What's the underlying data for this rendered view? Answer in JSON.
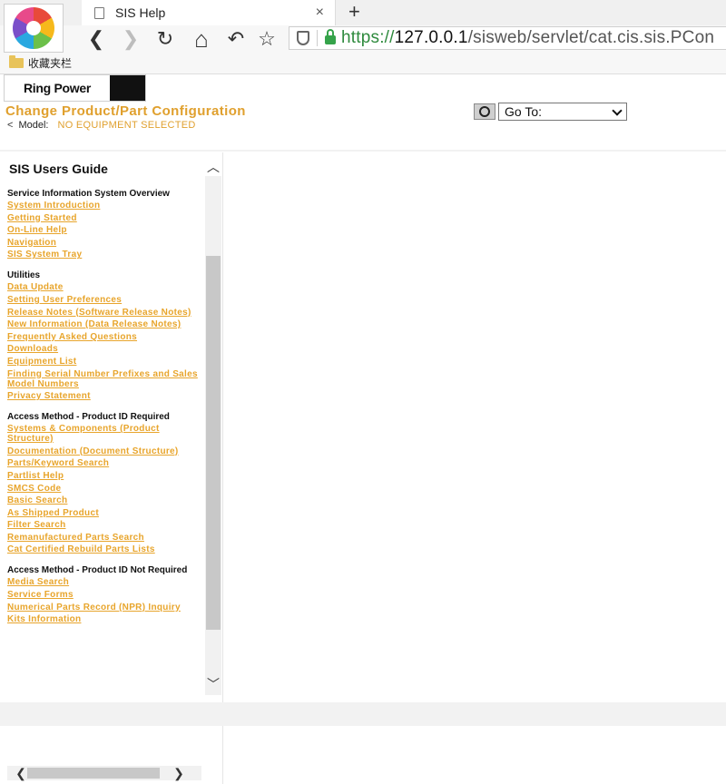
{
  "browser": {
    "tab_title": "SIS Help",
    "tab_close": "×",
    "new_tab": "+",
    "url_scheme": "https://",
    "url_host": "127.0.0.1",
    "url_path": "/sisweb/servlet/cat.cis.sis.PCon",
    "bookmark_folder_label": "收藏夹栏",
    "nav": {
      "back": "❮",
      "forward": "❯",
      "reload": "↻",
      "home": "⌂",
      "undo": "↶",
      "favorite": "☆"
    }
  },
  "header": {
    "brand_text": "Ring Power",
    "page_title": "Change Product/Part Configuration",
    "back_caret": "<",
    "model_label": "Model:",
    "model_value": "NO EQUIPMENT SELECTED",
    "goto_label": "Go To:"
  },
  "guide": {
    "title": "SIS Users Guide",
    "scroll_up": "︿",
    "scroll_down": "﹀",
    "scroll_left": "❮",
    "scroll_right": "❯",
    "sections": [
      {
        "heading": "Service Information System Overview",
        "links": [
          "System Introduction",
          "Getting Started",
          "On-Line Help",
          "Navigation",
          "SIS System Tray"
        ]
      },
      {
        "heading": "Utilities",
        "links": [
          "Data Update",
          "Setting User Preferences",
          "Release Notes (Software Release Notes)",
          "New Information (Data Release Notes)",
          "Frequently Asked Questions",
          "Downloads",
          "Equipment List",
          "Finding Serial Number Prefixes and Sales Model Numbers",
          "Privacy Statement"
        ]
      },
      {
        "heading": "Access Method - Product ID Required",
        "links": [
          "Systems & Components (Product Structure)",
          "Documentation (Document Structure)",
          "Parts/Keyword Search",
          "Partlist Help",
          "SMCS Code",
          "Basic Search",
          "As Shipped Product",
          "Filter Search",
          "Remanufactured Parts Search",
          "Cat Certified Rebuild Parts Lists"
        ]
      },
      {
        "heading": "Access Method - Product ID Not Required",
        "links": [
          "Media Search",
          "Service Forms",
          "Numerical Parts Record (NPR) Inquiry",
          "Kits Information"
        ]
      }
    ]
  }
}
